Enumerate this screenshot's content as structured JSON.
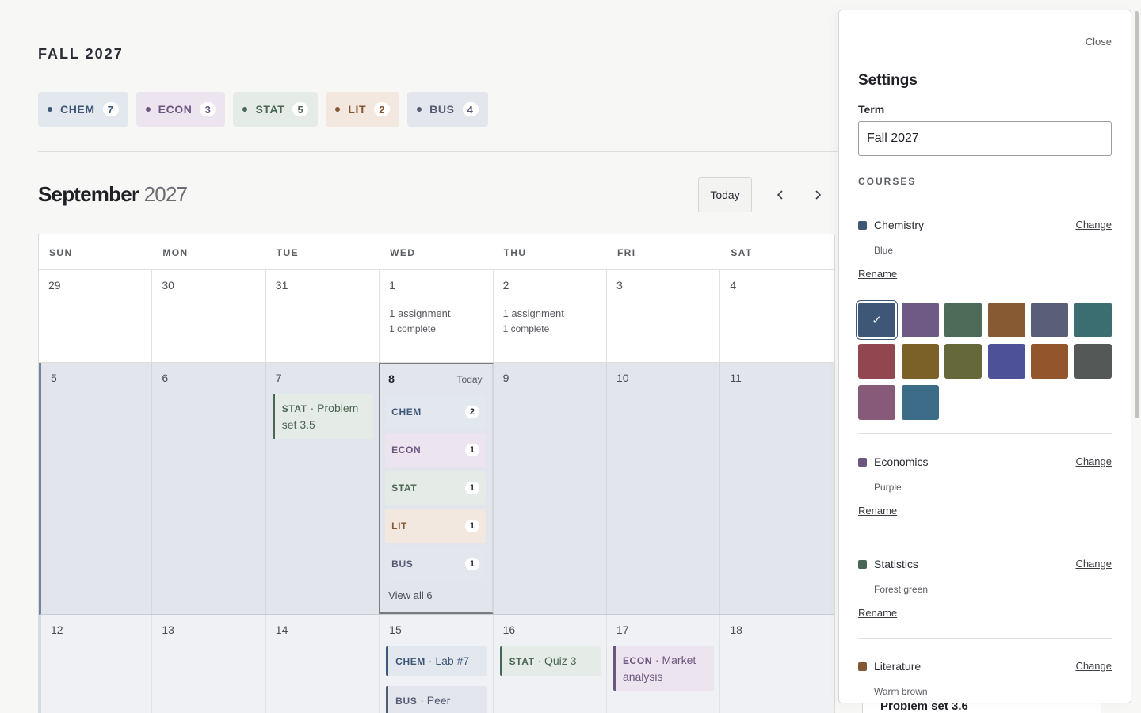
{
  "term": "FALL 2027",
  "chips": [
    {
      "code": "CHEM",
      "count": "7",
      "bg": "#e3e8ef",
      "fg": "#3e5776"
    },
    {
      "code": "ECON",
      "count": "3",
      "bg": "#ece4ef",
      "fg": "#6b5680"
    },
    {
      "code": "STAT",
      "count": "5",
      "bg": "#e5ebe6",
      "fg": "#4a6654"
    },
    {
      "code": "LIT",
      "count": "2",
      "bg": "#f2e8df",
      "fg": "#845632"
    },
    {
      "code": "BUS",
      "count": "4",
      "bg": "#e4e6ee",
      "fg": "#545a72"
    }
  ],
  "header": {
    "month": "September",
    "year": "2027",
    "today_label": "Today",
    "prev_icon": "chevron-left-icon",
    "next_icon": "chevron-right-icon"
  },
  "weekdays": [
    "SUN",
    "MON",
    "TUE",
    "WED",
    "THU",
    "FRI",
    "SAT"
  ],
  "week1": {
    "days": [
      "29",
      "30",
      "31",
      "1",
      "2",
      "3",
      "4"
    ],
    "wed_summary": {
      "assignments": "1 assignment",
      "complete": "1 complete"
    },
    "thu_summary": {
      "assignments": "1 assignment",
      "complete": "1 complete"
    }
  },
  "week2": {
    "days": [
      "5",
      "6",
      "7",
      "8",
      "9",
      "10",
      "11"
    ],
    "today_tag": "Today",
    "tue_event": {
      "code": "STAT",
      "title": " · Problem set 3.5"
    },
    "pills": [
      {
        "code": "CHEM",
        "count": "2"
      },
      {
        "code": "ECON",
        "count": "1"
      },
      {
        "code": "STAT",
        "count": "1"
      },
      {
        "code": "LIT",
        "count": "1"
      },
      {
        "code": "BUS",
        "count": "1"
      }
    ],
    "view_all": "View all 6"
  },
  "week3": {
    "days": [
      "12",
      "13",
      "14",
      "15",
      "16",
      "17",
      "18"
    ],
    "wed_event1": {
      "code": "CHEM",
      "title": " · Lab #7"
    },
    "wed_event2": {
      "code": "BUS",
      "title": " · Peer"
    },
    "thu_event": {
      "code": "STAT",
      "title": " · Quiz 3"
    },
    "fri_event": {
      "code": "ECON",
      "title": " · Market analysis"
    }
  },
  "peek_card": "Problem set 3.6",
  "settings": {
    "close_label": "Close",
    "title": "Settings",
    "term_label": "Term",
    "term_value": "Fall 2027",
    "courses_label": "COURSES",
    "change_label": "Change",
    "rename_label": "Rename",
    "courses": [
      {
        "name": "Chemistry",
        "color_name": "Blue",
        "color": "#3e5776"
      },
      {
        "name": "Economics",
        "color_name": "Purple",
        "color": "#6b5680"
      },
      {
        "name": "Statistics",
        "color_name": "Forest green",
        "color": "#4a6654"
      },
      {
        "name": "Literature",
        "color_name": "Warm brown",
        "color": "#845632"
      }
    ],
    "selected_check": "✓",
    "swatches": [
      "#3e5776",
      "#6f5a86",
      "#4d6b58",
      "#875a34",
      "#595f78",
      "#3b6e70",
      "#924650",
      "#7b6127",
      "#65693a",
      "#4d5197",
      "#93552b",
      "#545958",
      "#875a7a",
      "#3d6c88"
    ]
  }
}
